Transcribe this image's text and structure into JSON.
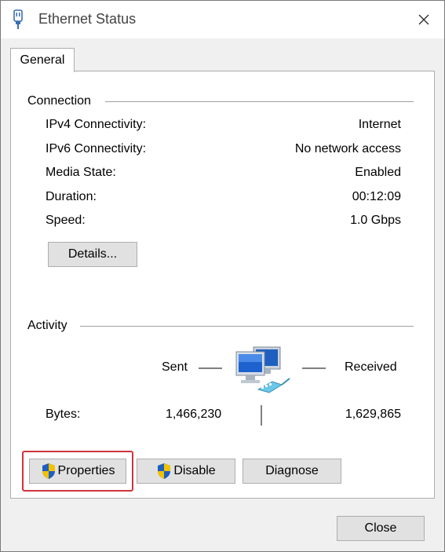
{
  "window": {
    "title": "Ethernet Status",
    "icons": {
      "app": "ethernet-connector-icon",
      "close": "close-icon"
    }
  },
  "tabs": [
    {
      "label": "General",
      "selected": true
    }
  ],
  "connection": {
    "heading": "Connection",
    "rows": [
      {
        "label": "IPv4 Connectivity:",
        "value": "Internet"
      },
      {
        "label": "IPv6 Connectivity:",
        "value": "No network access"
      },
      {
        "label": "Media State:",
        "value": "Enabled"
      },
      {
        "label": "Duration:",
        "value": "00:12:09"
      },
      {
        "label": "Speed:",
        "value": "1.0 Gbps"
      }
    ],
    "details_button": "Details..."
  },
  "activity": {
    "heading": "Activity",
    "sent_label": "Sent",
    "received_label": "Received",
    "bytes_label": "Bytes:",
    "bytes_sent": "1,466,230",
    "bytes_received": "1,629,865",
    "icon": "network-computers-icon"
  },
  "buttons": {
    "properties": "Properties",
    "disable": "Disable",
    "diagnose": "Diagnose",
    "close": "Close",
    "shield_icon": "uac-shield-icon"
  },
  "colors": {
    "highlight": "#d0353b",
    "shield_blue": "#1f5fbf",
    "shield_yellow": "#f2c200"
  }
}
